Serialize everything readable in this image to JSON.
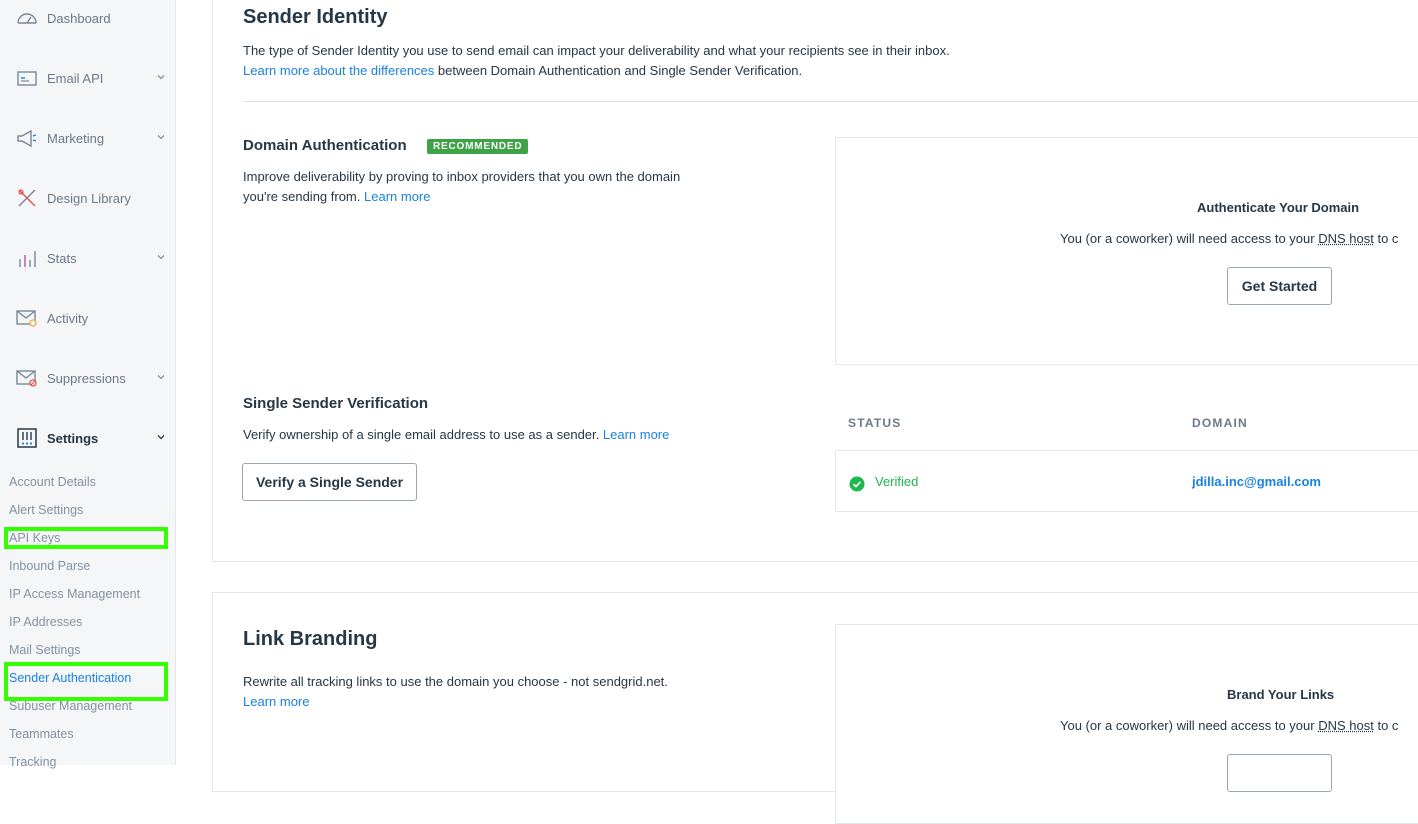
{
  "sidebar": {
    "items": [
      {
        "label": "Dashboard",
        "icon": "dashboard-icon",
        "has_chevron": false
      },
      {
        "label": "Email API",
        "icon": "email-api-icon",
        "has_chevron": true
      },
      {
        "label": "Marketing",
        "icon": "megaphone-icon",
        "has_chevron": true
      },
      {
        "label": "Design Library",
        "icon": "design-library-icon",
        "has_chevron": false
      },
      {
        "label": "Stats",
        "icon": "stats-icon",
        "has_chevron": true
      },
      {
        "label": "Activity",
        "icon": "activity-icon",
        "has_chevron": false
      },
      {
        "label": "Suppressions",
        "icon": "suppressions-icon",
        "has_chevron": true
      },
      {
        "label": "Settings",
        "icon": "settings-icon",
        "has_chevron": true
      }
    ],
    "settings_subitems": [
      "Account Details",
      "Alert Settings",
      "API Keys",
      "Inbound Parse",
      "IP Access Management",
      "IP Addresses",
      "Mail Settings",
      "Sender Authentication",
      "Subuser Management",
      "Teammates",
      "Tracking"
    ],
    "current_subitem": "Sender Authentication",
    "highlight_color": "#33ff00"
  },
  "sender_identity": {
    "title": "Sender Identity",
    "description": "The type of Sender Identity you use to send email can impact your deliverability and what your recipients see in their inbox.",
    "link_text": "Learn more about the differences",
    "link_suffix": " between Domain Authentication and Single Sender Verification."
  },
  "domain_auth": {
    "title": "Domain Authentication",
    "badge": "RECOMMENDED",
    "description_line1": "Improve deliverability by proving to inbox providers that you own the domain",
    "description_line2": "you're sending from. ",
    "learn_more": "Learn more",
    "panel_title": "Authenticate Your Domain",
    "panel_text_prefix": "You (or a coworker) will need access to your ",
    "panel_text_dns": "DNS host",
    "panel_text_suffix": " to c",
    "button": "Get Started"
  },
  "single_sender": {
    "title": "Single Sender Verification",
    "description": "Verify ownership of a single email address to use as a sender. ",
    "learn_more": "Learn more",
    "button": "Verify a Single Sender",
    "table": {
      "headers": [
        "STATUS",
        "DOMAIN"
      ],
      "rows": [
        {
          "status": "Verified",
          "domain": "jdilla.inc@gmail.com"
        }
      ]
    }
  },
  "link_branding": {
    "title": "Link Branding",
    "description": "Rewrite all tracking links to use the domain you choose - not sendgrid.net.",
    "learn_more": "Learn more",
    "panel_title": "Brand Your Links",
    "panel_text_prefix": "You (or a coworker) will need access to your ",
    "panel_text_dns": "DNS host",
    "panel_text_suffix": " to c"
  },
  "colors": {
    "link": "#1a82e2",
    "badge": "#3ea247",
    "verified": "#1eb84f",
    "text": "#263746"
  }
}
